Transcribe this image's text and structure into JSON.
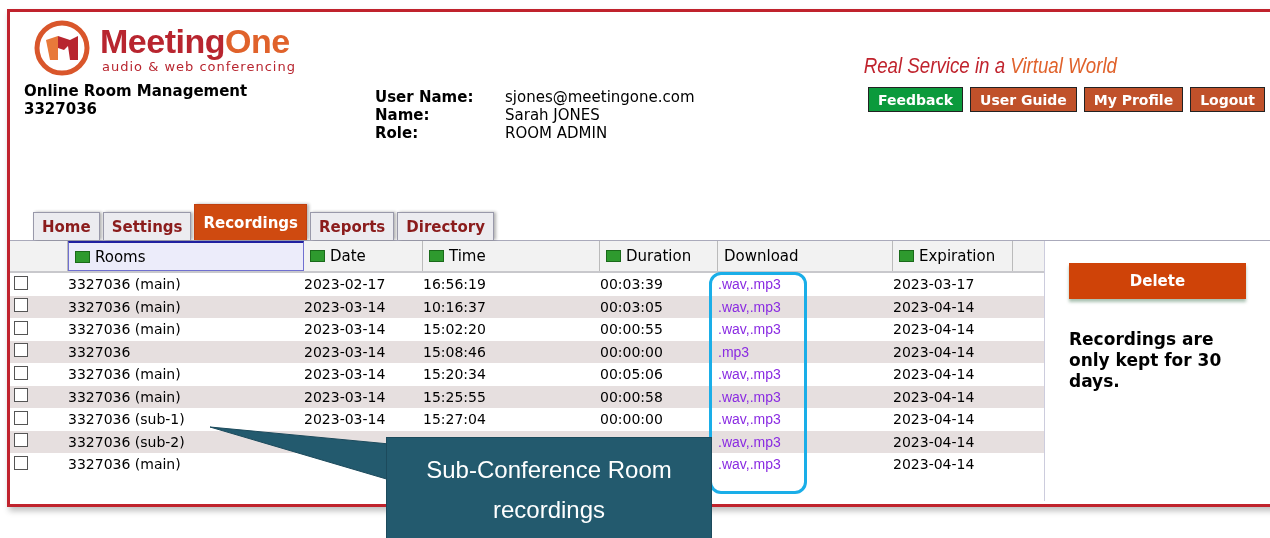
{
  "logo": {
    "wordmark": [
      "Meeting",
      "One"
    ],
    "subtitle": "audio & web conferencing"
  },
  "app": {
    "title": "Online Room Management",
    "room": "3327036"
  },
  "user": [
    {
      "label": "User Name:",
      "value": "sjones@meetingone.com"
    },
    {
      "label": "Name:",
      "value": "Sarah JONES"
    },
    {
      "label": "Role:",
      "value": "ROOM ADMIN"
    }
  ],
  "slogan": [
    "Real Service in a ",
    "Virtual World"
  ],
  "buttons": [
    {
      "label": "Feedback",
      "color": "#0b9a3c"
    },
    {
      "label": "User Guide",
      "color": "#c0512a"
    },
    {
      "label": "My Profile",
      "color": "#c0512a"
    },
    {
      "label": "Logout",
      "color": "#c0512a"
    }
  ],
  "tabs": [
    {
      "label": "Home",
      "selected": false
    },
    {
      "label": "Settings",
      "selected": false
    },
    {
      "label": "Recordings",
      "selected": true
    },
    {
      "label": "Reports",
      "selected": false
    },
    {
      "label": "Directory",
      "selected": false
    }
  ],
  "table": {
    "columns": [
      {
        "label": "Rooms",
        "sortable": true,
        "selected": true
      },
      {
        "label": "Date",
        "sortable": true,
        "selected": false
      },
      {
        "label": "Time",
        "sortable": true,
        "selected": false
      },
      {
        "label": "Duration",
        "sortable": true,
        "selected": false
      },
      {
        "label": "Download",
        "sortable": false,
        "selected": false
      },
      {
        "label": "Expiration",
        "sortable": true,
        "selected": false
      }
    ],
    "rows": [
      {
        "checked": false,
        "room": "3327036 (main)",
        "date": "2023-02-17",
        "time": "16:56:19",
        "duration": "00:03:39",
        "download": ".wav,.mp3",
        "expiration": "2023-03-17"
      },
      {
        "checked": false,
        "room": "3327036 (main)",
        "date": "2023-03-14",
        "time": "10:16:37",
        "duration": "00:03:05",
        "download": ".wav,.mp3",
        "expiration": "2023-04-14"
      },
      {
        "checked": false,
        "room": "3327036 (main)",
        "date": "2023-03-14",
        "time": "15:02:20",
        "duration": "00:00:55",
        "download": ".wav,.mp3",
        "expiration": "2023-04-14"
      },
      {
        "checked": false,
        "room": "3327036",
        "date": "2023-03-14",
        "time": "15:08:46",
        "duration": "00:00:00",
        "download": ".mp3",
        "expiration": "2023-04-14"
      },
      {
        "checked": false,
        "room": "3327036 (main)",
        "date": "2023-03-14",
        "time": "15:20:34",
        "duration": "00:05:06",
        "download": ".wav,.mp3",
        "expiration": "2023-04-14"
      },
      {
        "checked": false,
        "room": "3327036 (main)",
        "date": "2023-03-14",
        "time": "15:25:55",
        "duration": "00:00:58",
        "download": ".wav,.mp3",
        "expiration": "2023-04-14"
      },
      {
        "checked": false,
        "room": "3327036 (sub-1)",
        "date": "2023-03-14",
        "time": "15:27:04",
        "duration": "00:00:00",
        "download": ".wav,.mp3",
        "expiration": "2023-04-14"
      },
      {
        "checked": false,
        "room": "3327036 (sub-2)",
        "download": ".wav,.mp3",
        "expiration": "2023-04-14"
      },
      {
        "checked": false,
        "room": "3327036 (main)",
        "download": ".wav,.mp3",
        "expiration": "2023-04-14"
      }
    ]
  },
  "side": {
    "delete_button": "Delete",
    "note": "Recordings are only kept for 30 days."
  },
  "callout": {
    "text": "Sub-Conference Room recordings"
  }
}
